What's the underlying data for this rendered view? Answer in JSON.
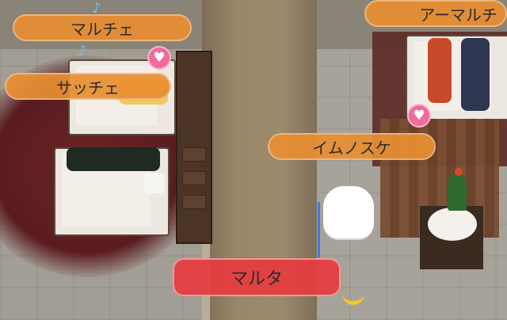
{
  "name_tags": {
    "top_left": "マルチェ",
    "mid_left": "サッチェ",
    "top_right": "アーマルチ",
    "mid_right": "イムノスケ",
    "bottom_selected": "マルタ"
  },
  "icons": {
    "heart": "heart-icon",
    "note": "music-note-icon",
    "banana": "banana-item"
  },
  "colors": {
    "tag_orange": "#e88e32",
    "tag_selected_red": "#e53c40",
    "heart_pink": "#f06a9c",
    "carpet": "#9a8668",
    "rug_red": "#5a1c20"
  }
}
